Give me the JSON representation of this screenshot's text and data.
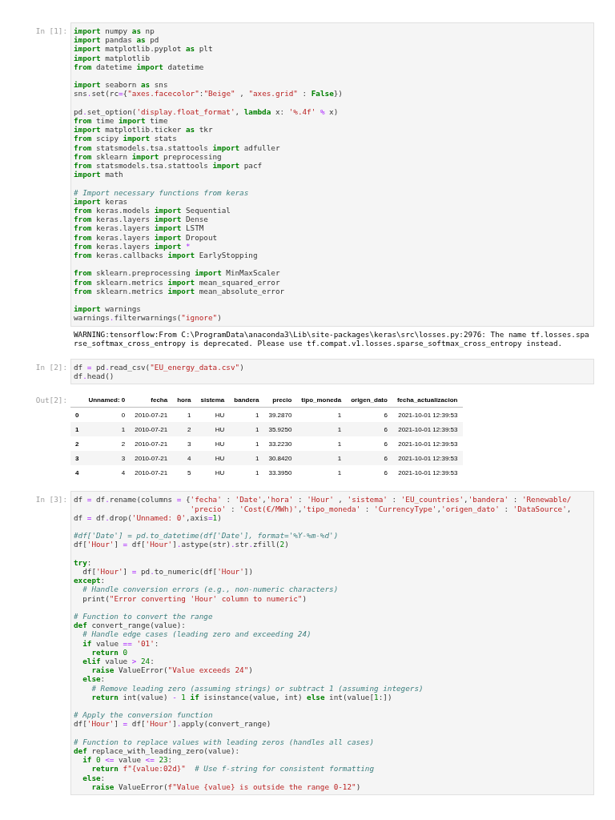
{
  "cells": [
    {
      "prompt": "In [1]:",
      "blocks": [
        [
          [
            {
              "kind": "keyword",
              "text": "import"
            },
            " numpy ",
            {
              "kind": "keyword",
              "text": "as"
            },
            " np"
          ],
          [
            {
              "kind": "keyword",
              "text": "import"
            },
            " pandas ",
            {
              "kind": "keyword",
              "text": "as"
            },
            " pd"
          ],
          [
            {
              "kind": "keyword",
              "text": "import"
            },
            " matplotlib.pyplot ",
            {
              "kind": "keyword",
              "text": "as"
            },
            " plt"
          ],
          [
            {
              "kind": "keyword",
              "text": "import"
            },
            " matplotlib"
          ],
          [
            {
              "kind": "keyword",
              "text": "from"
            },
            " datetime ",
            {
              "kind": "keyword",
              "text": "import"
            },
            " datetime"
          ]
        ],
        [
          [
            {
              "kind": "keyword",
              "text": "import"
            },
            " seaborn ",
            {
              "kind": "keyword",
              "text": "as"
            },
            " sns"
          ],
          [
            "sns",
            {
              "kind": "operator",
              "text": "."
            },
            "set(rc",
            {
              "kind": "operator",
              "text": "="
            },
            "{",
            {
              "kind": "string",
              "text": "\"axes.facecolor\""
            },
            ":",
            {
              "kind": "string",
              "text": "\"Beige\""
            },
            " , ",
            {
              "kind": "string",
              "text": "\"axes.grid\""
            },
            " : ",
            {
              "kind": "keyword",
              "text": "False"
            },
            "})"
          ]
        ],
        [
          [
            "pd",
            {
              "kind": "operator",
              "text": "."
            },
            "set_option(",
            {
              "kind": "string",
              "text": "'display.float_format'"
            },
            ", ",
            {
              "kind": "keyword",
              "text": "lambda"
            },
            " x: ",
            {
              "kind": "string",
              "text": "'%.4f'"
            },
            {
              "kind": "operator",
              "text": " %"
            },
            " x)"
          ],
          [
            {
              "kind": "keyword",
              "text": "from"
            },
            " time ",
            {
              "kind": "keyword",
              "text": "import"
            },
            " time"
          ],
          [
            {
              "kind": "keyword",
              "text": "import"
            },
            " matplotlib.ticker ",
            {
              "kind": "keyword",
              "text": "as"
            },
            " tkr"
          ],
          [
            {
              "kind": "keyword",
              "text": "from"
            },
            " scipy ",
            {
              "kind": "keyword",
              "text": "import"
            },
            " stats"
          ],
          [
            {
              "kind": "keyword",
              "text": "from"
            },
            " statsmodels.tsa.stattools ",
            {
              "kind": "keyword",
              "text": "import"
            },
            " adfuller"
          ],
          [
            {
              "kind": "keyword",
              "text": "from"
            },
            " sklearn ",
            {
              "kind": "keyword",
              "text": "import"
            },
            " preprocessing"
          ],
          [
            {
              "kind": "keyword",
              "text": "from"
            },
            " statsmodels.tsa.stattools ",
            {
              "kind": "keyword",
              "text": "import"
            },
            " pacf"
          ],
          [
            {
              "kind": "keyword",
              "text": "import"
            },
            " math"
          ]
        ],
        [
          [
            {
              "kind": "comment",
              "text": "# Import necessary functions from keras"
            }
          ],
          [
            {
              "kind": "keyword",
              "text": "import"
            },
            " keras"
          ],
          [
            {
              "kind": "keyword",
              "text": "from"
            },
            " keras.models ",
            {
              "kind": "keyword",
              "text": "import"
            },
            " Sequential"
          ],
          [
            {
              "kind": "keyword",
              "text": "from"
            },
            " keras.layers ",
            {
              "kind": "keyword",
              "text": "import"
            },
            " Dense"
          ],
          [
            {
              "kind": "keyword",
              "text": "from"
            },
            " keras.layers ",
            {
              "kind": "keyword",
              "text": "import"
            },
            " LSTM"
          ],
          [
            {
              "kind": "keyword",
              "text": "from"
            },
            " keras.layers ",
            {
              "kind": "keyword",
              "text": "import"
            },
            " Dropout"
          ],
          [
            {
              "kind": "keyword",
              "text": "from"
            },
            " keras.layers ",
            {
              "kind": "keyword",
              "text": "import"
            },
            {
              "kind": "operator",
              "text": " *"
            }
          ],
          [
            {
              "kind": "keyword",
              "text": "from"
            },
            " keras.callbacks ",
            {
              "kind": "keyword",
              "text": "import"
            },
            " EarlyStopping"
          ]
        ],
        [
          [
            {
              "kind": "keyword",
              "text": "from"
            },
            " sklearn.preprocessing ",
            {
              "kind": "keyword",
              "text": "import"
            },
            " MinMaxScaler"
          ],
          [
            {
              "kind": "keyword",
              "text": "from"
            },
            " sklearn.metrics ",
            {
              "kind": "keyword",
              "text": "import"
            },
            " mean_squared_error"
          ],
          [
            {
              "kind": "keyword",
              "text": "from"
            },
            " sklearn.metrics ",
            {
              "kind": "keyword",
              "text": "import"
            },
            " mean_absolute_error"
          ]
        ],
        [
          [
            {
              "kind": "keyword",
              "text": "import"
            },
            " warnings"
          ],
          [
            "warnings",
            {
              "kind": "operator",
              "text": "."
            },
            "filterwarnings(",
            {
              "kind": "string",
              "text": "\"ignore\""
            },
            ")"
          ]
        ]
      ],
      "output": {
        "kind": "stream",
        "text": "WARNING:tensorflow:From C:\\ProgramData\\anaconda3\\Lib\\site-packages\\keras\\src\\losses.py:2976: The name tf.losses.sparse_softmax_cross_entropy is deprecated. Please use tf.compat.v1.losses.sparse_softmax_cross_entropy instead."
      }
    },
    {
      "prompt": "In [2]:",
      "blocks": [
        [
          [
            "df ",
            {
              "kind": "operator",
              "text": "="
            },
            " pd",
            {
              "kind": "operator",
              "text": "."
            },
            "read_csv(",
            {
              "kind": "string",
              "text": "\"EU_energy_data.csv\""
            },
            ")"
          ],
          [
            "df",
            {
              "kind": "operator",
              "text": "."
            },
            "head()"
          ]
        ]
      ],
      "output_prompt": "Out[2]:",
      "output": {
        "kind": "table",
        "columns": [
          "Unnamed: 0",
          "fecha",
          "hora",
          "sistema",
          "bandera",
          "precio",
          "tipo_moneda",
          "origen_dato",
          "fecha_actualizacion"
        ],
        "rows": [
          {
            "index": "0",
            "cells": [
              "0",
              "2010-07-21",
              "1",
              "HU",
              "1",
              "39.2870",
              "1",
              "6",
              "2021-10-01 12:39:53"
            ]
          },
          {
            "index": "1",
            "cells": [
              "1",
              "2010-07-21",
              "2",
              "HU",
              "1",
              "35.9250",
              "1",
              "6",
              "2021-10-01 12:39:53"
            ]
          },
          {
            "index": "2",
            "cells": [
              "2",
              "2010-07-21",
              "3",
              "HU",
              "1",
              "33.2230",
              "1",
              "6",
              "2021-10-01 12:39:53"
            ]
          },
          {
            "index": "3",
            "cells": [
              "3",
              "2010-07-21",
              "4",
              "HU",
              "1",
              "30.8420",
              "1",
              "6",
              "2021-10-01 12:39:53"
            ]
          },
          {
            "index": "4",
            "cells": [
              "4",
              "2010-07-21",
              "5",
              "HU",
              "1",
              "33.3950",
              "1",
              "6",
              "2021-10-01 12:39:53"
            ]
          }
        ]
      }
    },
    {
      "prompt": "In [3]:",
      "blocks": [
        [
          [
            "df ",
            {
              "kind": "operator",
              "text": "="
            },
            " df",
            {
              "kind": "operator",
              "text": "."
            },
            "rename(columns ",
            {
              "kind": "operator",
              "text": "="
            },
            " {",
            {
              "kind": "string",
              "text": "'fecha'"
            },
            " : ",
            {
              "kind": "string",
              "text": "'Date'"
            },
            ",",
            {
              "kind": "string",
              "text": "'hora'"
            },
            " : ",
            {
              "kind": "string",
              "text": "'Hour'"
            },
            " , ",
            {
              "kind": "string",
              "text": "'sistema'"
            },
            " : ",
            {
              "kind": "string",
              "text": "'EU_countries'"
            },
            ",",
            {
              "kind": "string",
              "text": "'bandera'"
            },
            " : ",
            {
              "kind": "string",
              "text": "'Renewable/"
            }
          ],
          [
            {
              "kind": "string",
              "text": "                          'precio'"
            },
            " : ",
            {
              "kind": "string",
              "text": "'Cost(€/MWh)'"
            },
            ",",
            {
              "kind": "string",
              "text": "'tipo_moneda'"
            },
            " : ",
            {
              "kind": "string",
              "text": "'CurrencyType'"
            },
            ",",
            {
              "kind": "string",
              "text": "'origen_dato'"
            },
            " : ",
            {
              "kind": "string",
              "text": "'DataSource'"
            },
            ","
          ],
          [
            "df ",
            {
              "kind": "operator",
              "text": "="
            },
            " df",
            {
              "kind": "operator",
              "text": "."
            },
            "drop(",
            {
              "kind": "string",
              "text": "'Unnamed: 0'"
            },
            ",axis",
            {
              "kind": "operator",
              "text": "="
            },
            {
              "kind": "number",
              "text": "1"
            },
            ")"
          ]
        ],
        [
          [
            {
              "kind": "comment",
              "text": "#df['Date'] = pd.to_datetime(df['Date'], format='%Y-%m-%d')"
            }
          ],
          [
            "df[",
            {
              "kind": "string",
              "text": "'Hour'"
            },
            "] ",
            {
              "kind": "operator",
              "text": "="
            },
            " df[",
            {
              "kind": "string",
              "text": "'Hour'"
            },
            "]",
            {
              "kind": "operator",
              "text": "."
            },
            "astype(str)",
            {
              "kind": "operator",
              "text": "."
            },
            "str",
            {
              "kind": "operator",
              "text": "."
            },
            "zfill(",
            {
              "kind": "number",
              "text": "2"
            },
            ")"
          ]
        ],
        [
          [
            {
              "kind": "keyword",
              "text": "try"
            },
            ":"
          ],
          [
            "  df[",
            {
              "kind": "string",
              "text": "'Hour'"
            },
            "] ",
            {
              "kind": "operator",
              "text": "="
            },
            " pd",
            {
              "kind": "operator",
              "text": "."
            },
            "to_numeric(df[",
            {
              "kind": "string",
              "text": "'Hour'"
            },
            "])"
          ],
          [
            {
              "kind": "keyword",
              "text": "except"
            },
            ":"
          ],
          [
            {
              "kind": "comment",
              "text": "  # Handle conversion errors (e.g., non-numeric characters)"
            }
          ],
          [
            "  print(",
            {
              "kind": "string",
              "text": "\"Error converting 'Hour' column to numeric\""
            },
            ")"
          ]
        ],
        [
          [
            {
              "kind": "comment",
              "text": "# Function to convert the range"
            }
          ],
          [
            {
              "kind": "keyword",
              "text": "def"
            },
            " convert_range(value):"
          ],
          [
            {
              "kind": "comment",
              "text": "  # Handle edge cases (leading zero and exceeding 24)"
            }
          ],
          [
            {
              "kind": "keyword",
              "text": "  if"
            },
            " value ",
            {
              "kind": "operator",
              "text": "=="
            },
            {
              "kind": "string",
              "text": " '01'"
            },
            ":"
          ],
          [
            {
              "kind": "keyword",
              "text": "    return"
            },
            {
              "kind": "number",
              "text": " 0"
            }
          ],
          [
            {
              "kind": "keyword",
              "text": "  elif"
            },
            " value ",
            {
              "kind": "operator",
              "text": ">"
            },
            {
              "kind": "number",
              "text": " 24"
            },
            ":"
          ],
          [
            {
              "kind": "keyword",
              "text": "    raise"
            },
            " ValueError(",
            {
              "kind": "string",
              "text": "\"Value exceeds 24\""
            },
            ")"
          ],
          [
            {
              "kind": "keyword",
              "text": "  else"
            },
            ":"
          ],
          [
            {
              "kind": "comment",
              "text": "    # Remove leading zero (assuming strings) or subtract 1 (assuming integers)"
            }
          ],
          [
            {
              "kind": "keyword",
              "text": "    return"
            },
            " int(value) ",
            {
              "kind": "operator",
              "text": "-"
            },
            {
              "kind": "number",
              "text": " 1"
            },
            {
              "kind": "keyword",
              "text": " if"
            },
            " isinstance(value, int) ",
            {
              "kind": "keyword",
              "text": "else"
            },
            " int(value[",
            {
              "kind": "number",
              "text": "1"
            },
            ":])"
          ]
        ],
        [
          [
            {
              "kind": "comment",
              "text": "# Apply the conversion function"
            }
          ],
          [
            "df[",
            {
              "kind": "string",
              "text": "'Hour'"
            },
            "] ",
            {
              "kind": "operator",
              "text": "="
            },
            " df[",
            {
              "kind": "string",
              "text": "'Hour'"
            },
            "]",
            {
              "kind": "operator",
              "text": "."
            },
            "apply(convert_range)"
          ]
        ],
        [
          [
            {
              "kind": "comment",
              "text": "# Function to replace values with leading zeros (handles all cases)"
            }
          ],
          [
            {
              "kind": "keyword",
              "text": "def"
            },
            " replace_with_leading_zero(value):"
          ],
          [
            {
              "kind": "keyword",
              "text": "  if"
            },
            {
              "kind": "number",
              "text": " 0"
            },
            {
              "kind": "operator",
              "text": " <="
            },
            " value ",
            {
              "kind": "operator",
              "text": "<="
            },
            {
              "kind": "number",
              "text": " 23"
            },
            ":"
          ],
          [
            {
              "kind": "keyword",
              "text": "    return"
            },
            {
              "kind": "string",
              "text": " f\"{value:02d}\""
            },
            {
              "kind": "comment",
              "text": "  # Use f-string for consistent formatting"
            }
          ],
          [
            {
              "kind": "keyword",
              "text": "  else"
            },
            ":"
          ],
          [
            {
              "kind": "keyword",
              "text": "    raise"
            },
            " ValueError(",
            {
              "kind": "string",
              "text": "f\"Value {value} is outside the range 0-12\""
            },
            ")"
          ]
        ]
      ]
    }
  ]
}
